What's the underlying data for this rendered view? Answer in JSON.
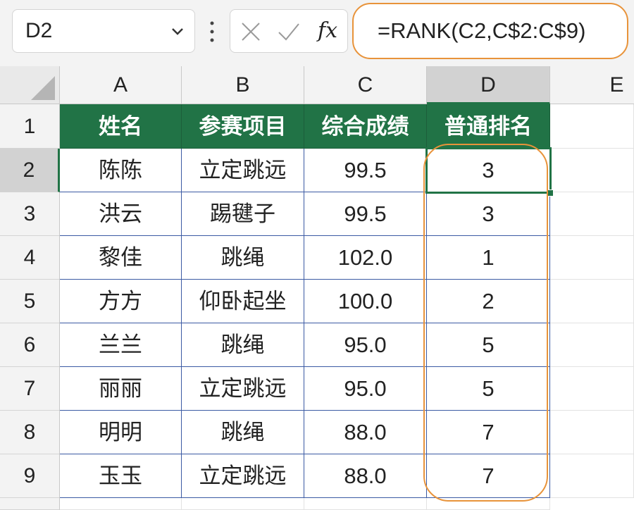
{
  "name_box": {
    "value": "D2"
  },
  "formula_bar": {
    "cancel_icon": "x-icon",
    "enter_icon": "check-icon",
    "fx_label": "fx",
    "formula": "=RANK(C2,C$2:C$9)"
  },
  "columns": [
    "A",
    "B",
    "C",
    "D",
    "E"
  ],
  "rows": [
    "1",
    "2",
    "3",
    "4",
    "5",
    "6",
    "7",
    "8",
    "9"
  ],
  "table": {
    "headers": [
      "姓名",
      "参赛项目",
      "综合成绩",
      "普通排名"
    ],
    "rows": [
      [
        "陈陈",
        "立定跳远",
        "99.5",
        "3"
      ],
      [
        "洪云",
        "踢毽子",
        "99.5",
        "3"
      ],
      [
        "黎佳",
        "跳绳",
        "102.0",
        "1"
      ],
      [
        "方方",
        "仰卧起坐",
        "100.0",
        "2"
      ],
      [
        "兰兰",
        "跳绳",
        "95.0",
        "5"
      ],
      [
        "丽丽",
        "立定跳远",
        "95.0",
        "5"
      ],
      [
        "明明",
        "跳绳",
        "88.0",
        "7"
      ],
      [
        "玉玉",
        "立定跳远",
        "88.0",
        "7"
      ]
    ]
  },
  "colors": {
    "header_fill": "#217346",
    "highlight": "#e8933a",
    "grid": "#3b5aa3"
  }
}
